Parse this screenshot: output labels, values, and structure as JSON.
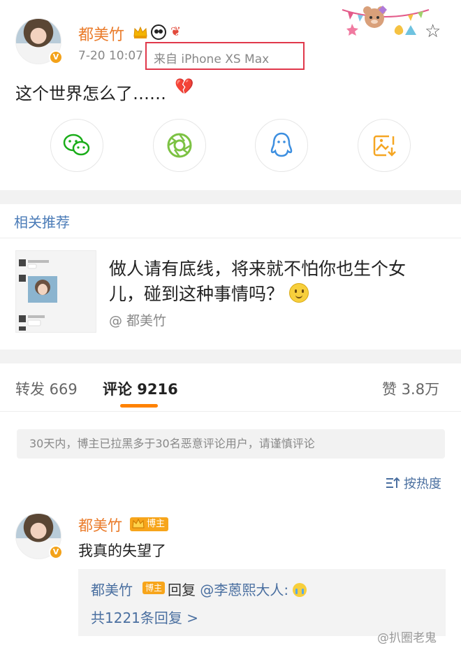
{
  "post": {
    "username": "都美竹",
    "time": "7-20 10:07",
    "source": "来自 iPhone XS Max",
    "text": "这个世界怎么了……",
    "verified_mark": "V",
    "icons": [
      "crown-icon",
      "panda-icon",
      "bow-icon",
      "broken-heart-icon",
      "star-icon"
    ]
  },
  "share": {
    "buttons": [
      "wechat-icon",
      "moments-icon",
      "qq-icon",
      "save-image-icon"
    ],
    "colors": {
      "wechat": "#1aad19",
      "moments": "#7cc243",
      "qq": "#3d8fe0",
      "save": "#f5a623"
    }
  },
  "recommend": {
    "title": "相关推荐",
    "text_line1": "做人请有底线，将来就不怕你也生个女",
    "text_line2": "儿，碰到这种事情吗？",
    "author": "@ 都美竹"
  },
  "tabs": {
    "repost": "转发 669",
    "comments": "评论 9216",
    "likes": "赞 3.8万"
  },
  "notice": "30天内，博主已拉黑多于30名恶意评论用户，请谨慎评论",
  "sort_label": "按热度",
  "comment": {
    "username": "都美竹",
    "badge": "博主",
    "text": "我真的失望了",
    "reply": {
      "username": "都美竹",
      "badge": "博主",
      "prefix": "回复",
      "mention": "@李蒽熙大人:",
      "more": "共1221条回复 >"
    }
  },
  "watermark": "@扒圈老鬼",
  "colors": {
    "accent_orange": "#ff8200",
    "name_orange": "#ea7b2a",
    "link_blue": "#4a6fa0",
    "highlight_red": "#e0384b"
  }
}
